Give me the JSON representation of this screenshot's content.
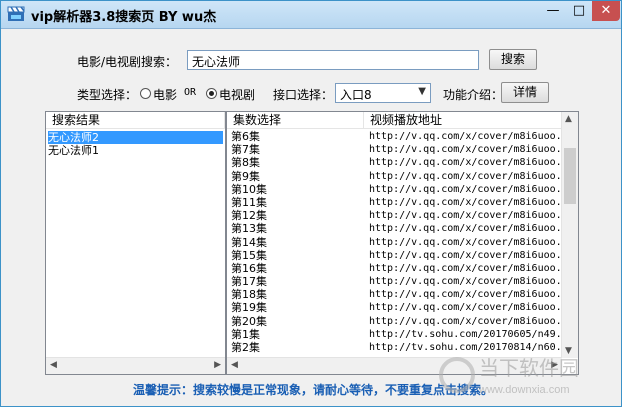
{
  "window": {
    "title": "vip解析器3.8搜索页 BY wu杰",
    "controls": {
      "minimize": "—",
      "maximize": "□",
      "close": "✕"
    },
    "accent": "#c75050"
  },
  "search": {
    "label": "电影/电视剧搜索：",
    "value": "无心法师",
    "button": "搜索"
  },
  "type_select": {
    "label": "类型选择：",
    "option_movie": "电影",
    "or": "OR",
    "option_tv": "电视剧",
    "selected": "电视剧"
  },
  "interface": {
    "label": "接口选择：",
    "selected": "入口8"
  },
  "feature": {
    "label": "功能介绍：",
    "button": "详情"
  },
  "results": {
    "header": "搜索结果",
    "items": [
      "无心法师2",
      "无心法师1"
    ],
    "selected_index": 0
  },
  "episodes": {
    "col_episode": "集数选择",
    "col_url": "视频播放地址",
    "rows": [
      {
        "ep": "第6集",
        "url": "http://v.qq.com/x/cover/m8i6uoo."
      },
      {
        "ep": "第7集",
        "url": "http://v.qq.com/x/cover/m8i6uoo."
      },
      {
        "ep": "第8集",
        "url": "http://v.qq.com/x/cover/m8i6uoo."
      },
      {
        "ep": "第9集",
        "url": "http://v.qq.com/x/cover/m8i6uoo."
      },
      {
        "ep": "第10集",
        "url": "http://v.qq.com/x/cover/m8i6uoo."
      },
      {
        "ep": "第11集",
        "url": "http://v.qq.com/x/cover/m8i6uoo."
      },
      {
        "ep": "第12集",
        "url": "http://v.qq.com/x/cover/m8i6uoo."
      },
      {
        "ep": "第13集",
        "url": "http://v.qq.com/x/cover/m8i6uoo."
      },
      {
        "ep": "第14集",
        "url": "http://v.qq.com/x/cover/m8i6uoo."
      },
      {
        "ep": "第15集",
        "url": "http://v.qq.com/x/cover/m8i6uoo."
      },
      {
        "ep": "第16集",
        "url": "http://v.qq.com/x/cover/m8i6uoo."
      },
      {
        "ep": "第17集",
        "url": "http://v.qq.com/x/cover/m8i6uoo."
      },
      {
        "ep": "第18集",
        "url": "http://v.qq.com/x/cover/m8i6uoo."
      },
      {
        "ep": "第19集",
        "url": "http://v.qq.com/x/cover/m8i6uoo."
      },
      {
        "ep": "第20集",
        "url": "http://v.qq.com/x/cover/m8i6uoo."
      },
      {
        "ep": "第1集",
        "url": "http://tv.sohu.com/20170605/n49."
      },
      {
        "ep": "第2集",
        "url": "http://tv.sohu.com/20170814/n60."
      }
    ]
  },
  "tip": "温馨提示：搜索较慢是正常现象，请耐心等待，不要重复点击搜索。",
  "watermark": {
    "brand": "当下软件园",
    "site": "www.downxia.com"
  }
}
